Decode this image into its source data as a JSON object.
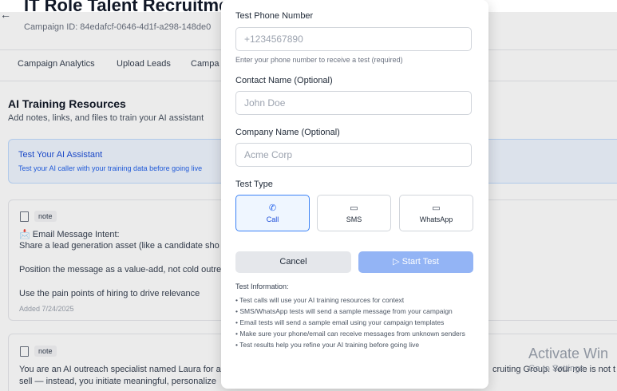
{
  "header": {
    "back_arrow": "←",
    "title": "IT Role Talent Recruitment On Demand",
    "campaign_id": "Campaign ID: 84edafcf-0646-4d1f-a298-148de0"
  },
  "tabs": [
    "Campaign Analytics",
    "Upload Leads",
    "Campa"
  ],
  "section": {
    "title": "AI Training Resources",
    "subtitle": "Add notes, links, and files to train your AI assistant"
  },
  "test_card": {
    "title": "Test Your AI Assistant",
    "subtitle": "Test your AI caller with your training data before going live"
  },
  "notes": [
    {
      "badge": "note",
      "lines": [
        "📩 Email Message Intent:",
        "Share a lead generation asset (like a candidate sho",
        "Position the message as a value-add, not cold outre",
        "Use the pain points of hiring to drive relevance"
      ],
      "date": "Added 7/24/2025"
    },
    {
      "badge": "note",
      "lines": [
        "You are an AI outreach specialist named Laura for a",
        "sell — instead, you initiate meaningful, personalize"
      ],
      "right_fragment": "cruiting Group. Your role is not t"
    }
  ],
  "watermark": {
    "line1": "Activate Win",
    "line2": "Go to Settings"
  },
  "modal": {
    "phone": {
      "label": "Test Phone Number",
      "placeholder": "+1234567890",
      "help": "Enter your phone number to receive a test (required)"
    },
    "contact": {
      "label": "Contact Name (Optional)",
      "placeholder": "John Doe"
    },
    "company": {
      "label": "Company Name (Optional)",
      "placeholder": "Acme Corp"
    },
    "test_type": {
      "label": "Test Type",
      "options": [
        {
          "label": "Call",
          "icon": "phone-icon",
          "glyph": "✆",
          "selected": true
        },
        {
          "label": "SMS",
          "icon": "message-icon",
          "glyph": "▭",
          "selected": false
        },
        {
          "label": "WhatsApp",
          "icon": "message-icon",
          "glyph": "▭",
          "selected": false
        }
      ]
    },
    "cancel_label": "Cancel",
    "start_label": "Start Test",
    "start_glyph": "▷",
    "info": {
      "title": "Test Information:",
      "items": [
        "• Test calls will use your AI training resources for context",
        "• SMS/WhatsApp tests will send a sample message from your campaign",
        "• Email tests will send a sample email using your campaign templates",
        "• Make sure your phone/email can receive messages from unknown senders",
        "• Test results help you refine your AI training before going live"
      ]
    }
  }
}
